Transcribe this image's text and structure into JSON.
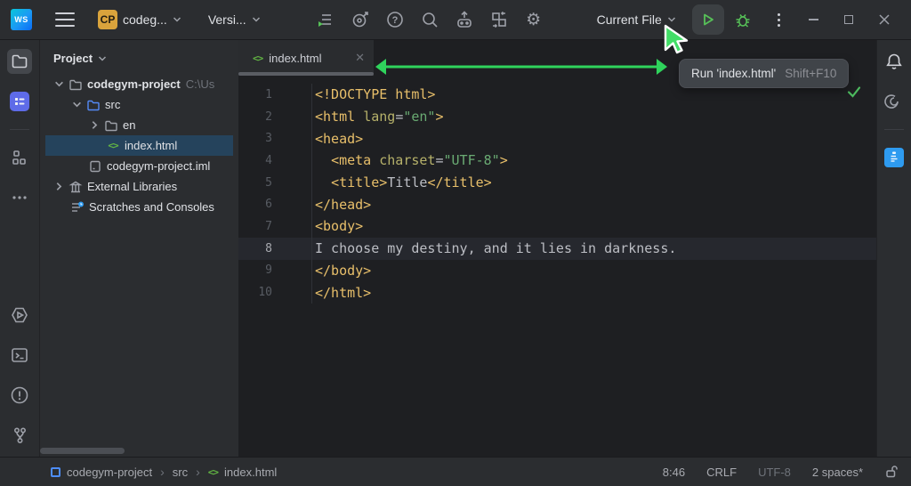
{
  "app": {
    "name_initials": "WS"
  },
  "colors": {
    "accent_green": "#57C258",
    "annotation_green": "#2FD35C",
    "selection_blue": "#25435C",
    "learn_blue": "#5E6BE8",
    "clipboard_blue": "#2E9BF0",
    "badge_gold": "#D9A33C",
    "tag_yellow": "#E8BF6A",
    "string_green": "#6AAB73"
  },
  "titlebar": {
    "project_badge": "CP",
    "project_name": "codeg...",
    "vcs_widget": "Versi...",
    "run_config": "Current File",
    "toolbar_icons": [
      "run-configurations-icon",
      "target-icon",
      "help-icon",
      "search-icon",
      "controller-upload-icon",
      "layout-switch-icon",
      "settings-gear-icon"
    ],
    "gear_glyph": "⚙"
  },
  "left_strip": {
    "top": [
      "project",
      "learn-plugin",
      "structure",
      "more-tool-windows"
    ],
    "bottom": [
      "services",
      "terminal",
      "problems",
      "version-control"
    ]
  },
  "right_strip": [
    "notifications",
    "ai-assistant",
    "learner-tasks"
  ],
  "project_panel": {
    "header": "Project",
    "tree": [
      {
        "label": "codegym-project",
        "suffix": "C:\\Us",
        "icon": "folder",
        "chevron": "open",
        "indent": 0,
        "bold": true
      },
      {
        "label": "src",
        "icon": "folder-blue",
        "chevron": "open",
        "indent": 1
      },
      {
        "label": "en",
        "icon": "folder",
        "chevron": "closed",
        "indent": 2
      },
      {
        "label": "index.html",
        "icon": "html",
        "chevron": null,
        "indent": 3,
        "selected": true
      },
      {
        "label": "codegym-project.iml",
        "icon": "iml",
        "chevron": null,
        "indent": 2
      },
      {
        "label": "External Libraries",
        "icon": "lib",
        "chevron": "closed",
        "indent": 0
      },
      {
        "label": "Scratches and Consoles",
        "icon": "scratch",
        "chevron": null,
        "indent": 1
      }
    ]
  },
  "editor": {
    "tab": {
      "name": "index.html",
      "close_glyph": "✕"
    },
    "html_mark": "<>",
    "lines": [
      {
        "n": "1",
        "t": [
          [
            "tg",
            "<!DOCTYPE html>"
          ]
        ]
      },
      {
        "n": "2",
        "t": [
          [
            "tg",
            "<html "
          ],
          [
            "at",
            "lang"
          ],
          [
            "eq",
            "="
          ],
          [
            "st",
            "\"en\""
          ],
          [
            "tg",
            ">"
          ]
        ]
      },
      {
        "n": "3",
        "t": [
          [
            "tg",
            "<head>"
          ]
        ]
      },
      {
        "n": "4",
        "t": [
          [
            "tx",
            "  "
          ],
          [
            "tg",
            "<meta "
          ],
          [
            "at",
            "charset"
          ],
          [
            "eq",
            "="
          ],
          [
            "st",
            "\"UTF-8\""
          ],
          [
            "tg",
            ">"
          ]
        ]
      },
      {
        "n": "5",
        "t": [
          [
            "tx",
            "  "
          ],
          [
            "tg",
            "<title>"
          ],
          [
            "tx",
            "Title"
          ],
          [
            "tg",
            "</title>"
          ]
        ]
      },
      {
        "n": "6",
        "t": [
          [
            "tg",
            "</head>"
          ]
        ]
      },
      {
        "n": "7",
        "t": [
          [
            "tg",
            "<body>"
          ]
        ]
      },
      {
        "n": "8",
        "t": [
          [
            "tx",
            "I choose my destiny, and it lies in darkness."
          ]
        ],
        "current": true
      },
      {
        "n": "9",
        "t": [
          [
            "tg",
            "</body>"
          ]
        ]
      },
      {
        "n": "10",
        "t": [
          [
            "tg",
            "</html>"
          ]
        ]
      }
    ],
    "browser_icons": [
      "edge",
      "chrome",
      "firefox",
      "safari"
    ]
  },
  "tooltip": {
    "label": "Run 'index.html'",
    "shortcut": "Shift+F10"
  },
  "statusbar": {
    "breadcrumbs": [
      "codegym-project",
      "src",
      "index.html"
    ],
    "separator": "›",
    "caret_position": "8:46",
    "line_separator": "CRLF",
    "encoding": "UTF-8",
    "indent": "2 spaces*"
  }
}
